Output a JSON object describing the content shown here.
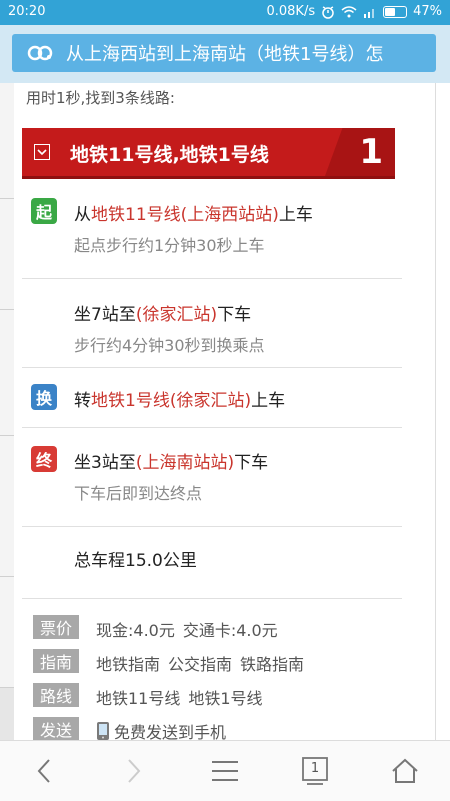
{
  "status": {
    "time": "20:20",
    "speed": "0.08K/s",
    "battery": "47%",
    "battery_level": 0.47
  },
  "header": {
    "title": "从上海西站到上海南站（地铁1号线）怎"
  },
  "summary": "用时1秒,找到3条线路:",
  "route": {
    "name": "地铁11号线,地铁1号线",
    "number": "1",
    "steps": [
      {
        "icon_label": "起",
        "icon_color": "#3aa845",
        "prefix": "从",
        "highlight": "地铁11号线(上海西站站)",
        "suffix": "上车",
        "detail": "起点步行约1分钟30秒上车"
      },
      {
        "icon_label": "",
        "icon_color": "",
        "prefix": "坐7站至",
        "highlight": "(徐家汇站)",
        "suffix": "下车",
        "detail": "步行约4分钟30秒到换乘点"
      },
      {
        "icon_label": "换",
        "icon_color": "#3b83c7",
        "prefix": "转",
        "highlight": "地铁1号线(徐家汇站)",
        "suffix": "上车",
        "detail": ""
      },
      {
        "icon_label": "终",
        "icon_color": "#d83b35",
        "prefix": "坐3站至",
        "highlight": "(上海南站站)",
        "suffix": "下车",
        "detail": "下车后即到达终点"
      }
    ],
    "total": "总车程15.0公里"
  },
  "info": [
    {
      "label": "票价",
      "items": [
        "现金:4.0元",
        "交通卡:4.0元"
      ]
    },
    {
      "label": "指南",
      "items": [
        "地铁指南",
        "公交指南",
        "铁路指南"
      ]
    },
    {
      "label": "路线",
      "items": [
        "地铁11号线",
        "地铁1号线"
      ]
    },
    {
      "label": "发送",
      "items": [
        "免费发送到手机"
      ]
    }
  ],
  "nav": {
    "tab_count": "1",
    "icons": [
      "back-icon",
      "forward-icon",
      "menu-icon",
      "tabs-icon",
      "home-icon"
    ]
  }
}
